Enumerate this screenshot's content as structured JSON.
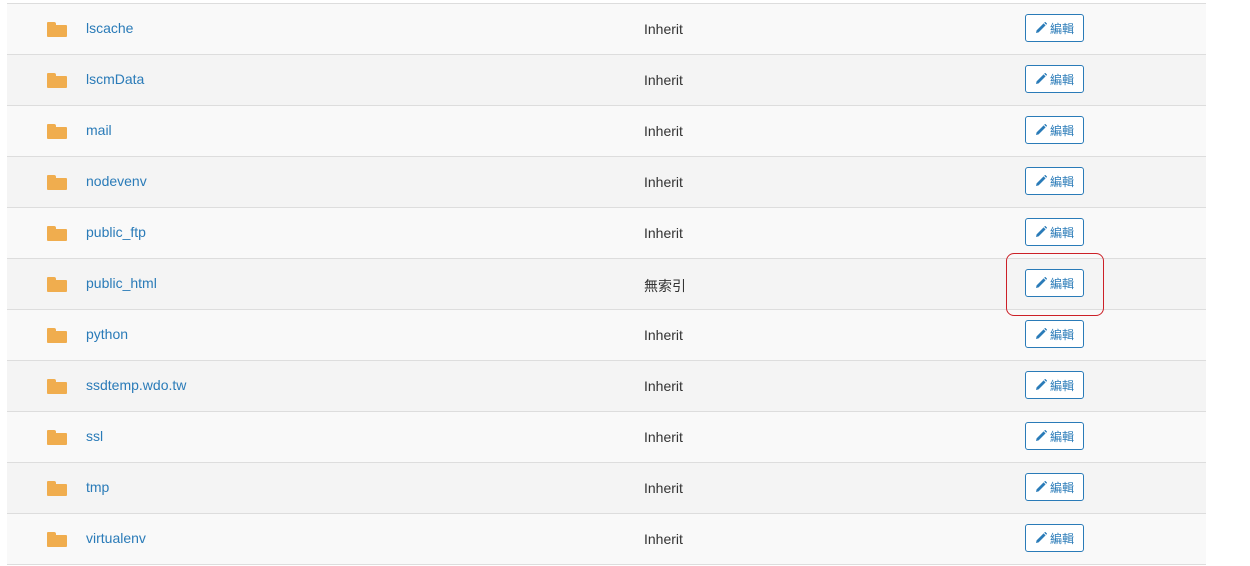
{
  "directories": [
    {
      "name": "lscache",
      "index": "Inherit",
      "edit_label": "編輯"
    },
    {
      "name": "lscmData",
      "index": "Inherit",
      "edit_label": "編輯"
    },
    {
      "name": "mail",
      "index": "Inherit",
      "edit_label": "編輯"
    },
    {
      "name": "nodevenv",
      "index": "Inherit",
      "edit_label": "編輯"
    },
    {
      "name": "public_ftp",
      "index": "Inherit",
      "edit_label": "編輯"
    },
    {
      "name": "public_html",
      "index": "無索引",
      "edit_label": "編輯"
    },
    {
      "name": "python",
      "index": "Inherit",
      "edit_label": "編輯"
    },
    {
      "name": "ssdtemp.wdo.tw",
      "index": "Inherit",
      "edit_label": "編輯"
    },
    {
      "name": "ssl",
      "index": "Inherit",
      "edit_label": "編輯"
    },
    {
      "name": "tmp",
      "index": "Inherit",
      "edit_label": "編輯"
    },
    {
      "name": "virtualenv",
      "index": "Inherit",
      "edit_label": "編輯"
    }
  ],
  "icons": {
    "folder": "folder-icon",
    "edit": "pencil-icon"
  },
  "colors": {
    "link": "#2a7bb8",
    "folder": "#f0ad4e",
    "highlight": "#cc2027"
  }
}
